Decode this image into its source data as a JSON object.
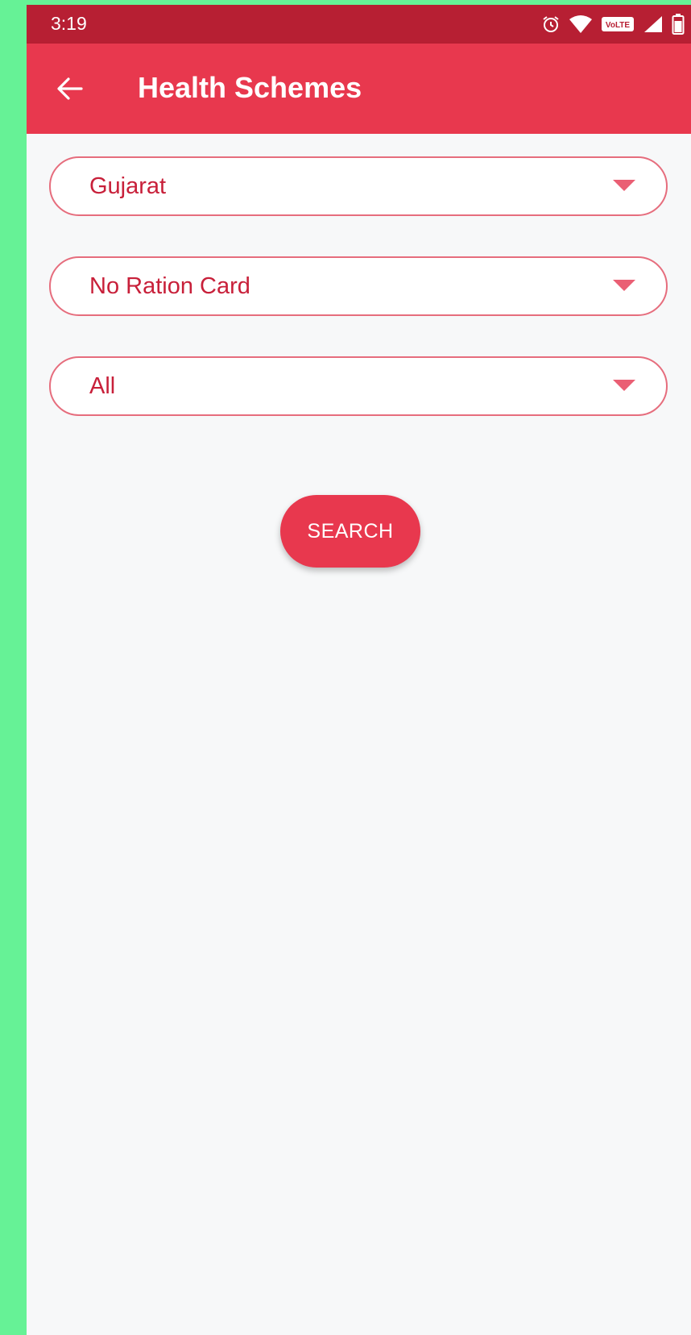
{
  "colors": {
    "frame_background": "#66f296",
    "status_bar": "#b71f33",
    "app_bar": "#e8384e",
    "content_background": "#f7f8f9",
    "dropdown_border": "#e66d7d",
    "dropdown_text": "#c8203a",
    "dropdown_arrow": "#ea5f74",
    "button_background": "#e8384e",
    "white": "#ffffff"
  },
  "status_bar": {
    "time": "3:19",
    "icons": [
      "alarm-icon",
      "wifi-icon",
      "volte-icon",
      "signal-icon",
      "battery-icon"
    ],
    "volte_label": "VoLTE"
  },
  "app_bar": {
    "back_icon": "arrow-left-icon",
    "title": "Health Schemes"
  },
  "filters": {
    "state": {
      "selected": "Gujarat"
    },
    "ration_card": {
      "selected": "No Ration Card"
    },
    "category": {
      "selected": "All"
    }
  },
  "search_button": {
    "label": "SEARCH"
  }
}
